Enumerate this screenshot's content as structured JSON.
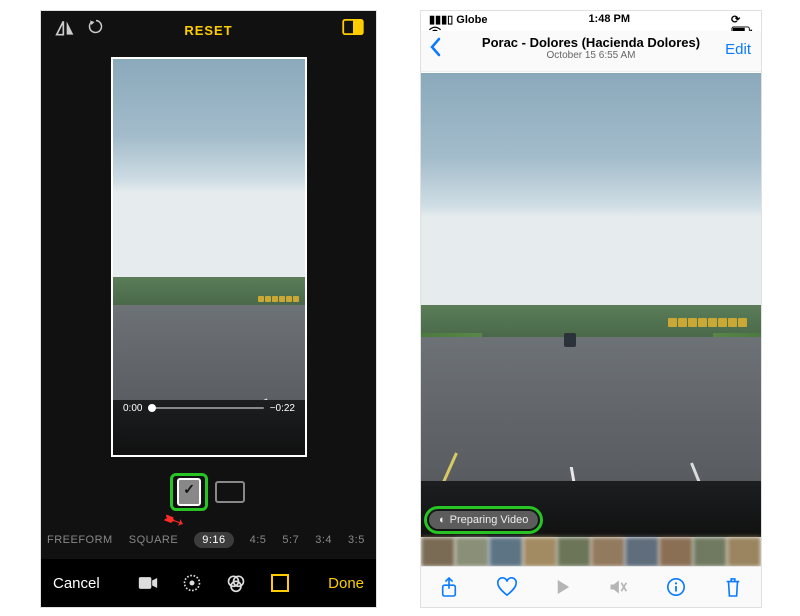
{
  "left": {
    "reset": "RESET",
    "time_start": "0:00",
    "time_end": "−0:22",
    "ratios": [
      "FREEFORM",
      "SQUARE",
      "9:16",
      "4:5",
      "5:7",
      "3:4",
      "3:5"
    ],
    "selected_ratio": "9:16",
    "cancel": "Cancel",
    "done": "Done"
  },
  "right": {
    "status_left": "Globe",
    "status_time": "1:48 PM",
    "title": "Porac - Dolores (Hacienda Dolores)",
    "subtitle": "October 15  6:55 AM",
    "edit": "Edit",
    "preparing": "Preparing Video"
  },
  "colors": {
    "accent_yellow": "#ffcc00",
    "ios_blue": "#0a7aff",
    "highlight": "#27c423",
    "arrow": "#ff2a2a"
  }
}
